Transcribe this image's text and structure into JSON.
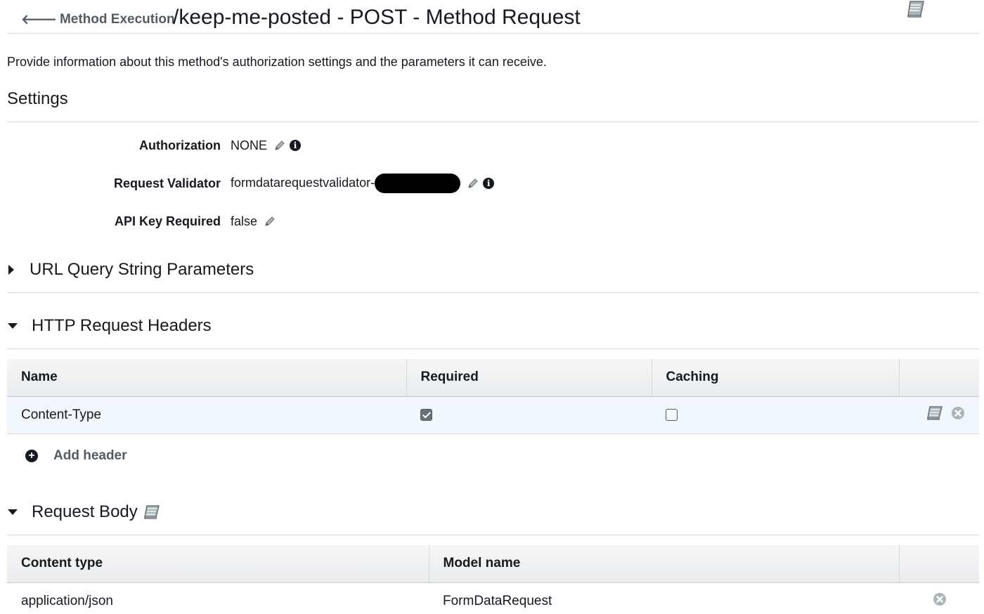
{
  "header": {
    "back_label": "Method Execution",
    "title": "/keep-me-posted - POST - Method Request"
  },
  "intro": "Provide information about this method's authorization settings and the parameters it can receive.",
  "settings": {
    "title": "Settings",
    "authorization": {
      "label": "Authorization",
      "value": "NONE"
    },
    "request_validator": {
      "label": "Request Validator",
      "value": "formdatarequestvalidator-"
    },
    "api_key_required": {
      "label": "API Key Required",
      "value": "false"
    }
  },
  "sections": {
    "url_query": {
      "title": "URL Query String Parameters",
      "expanded": false
    },
    "http_headers": {
      "title": "HTTP Request Headers",
      "expanded": true
    },
    "request_body": {
      "title": "Request Body",
      "expanded": true
    }
  },
  "headers_table": {
    "columns": [
      "Name",
      "Required",
      "Caching",
      ""
    ],
    "rows": [
      {
        "name": "Content-Type",
        "required": true,
        "caching": false
      }
    ],
    "add_label": "Add header"
  },
  "body_table": {
    "columns": [
      "Content type",
      "Model name",
      ""
    ],
    "rows": [
      {
        "content_type": "application/json",
        "model_name": "FormDataRequest"
      }
    ]
  },
  "icons": {
    "back": "arrow-left-icon",
    "docs": "book-icon",
    "edit": "pencil-icon",
    "info": "info-icon",
    "remove": "remove-circle-icon",
    "add": "plus-circle-icon"
  }
}
